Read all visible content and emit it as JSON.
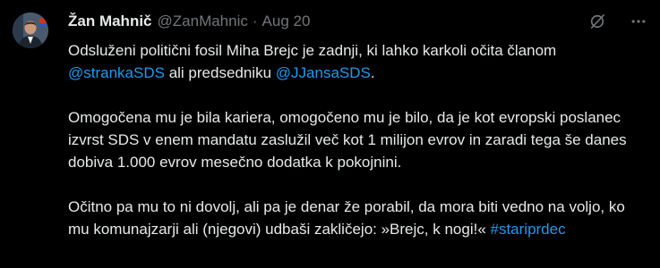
{
  "author": {
    "name": "Žan Mahnič",
    "handle": "@ZanMahnic",
    "separator": "·",
    "date": "Aug 20"
  },
  "icons": {
    "grok": "grok-icon",
    "more": "more-icon"
  },
  "colors": {
    "background": "#000000",
    "text": "#e7e9ea",
    "muted": "#71767b",
    "link": "#1d9bf0"
  },
  "tweet": {
    "p1": {
      "text1": "Odsluženi politični fosil Miha Brejc je zadnji, ki lahko karkoli očita članom ",
      "mention1": "@strankaSDS",
      "text2": " ali predsedniku  ",
      "mention2": "@JJansaSDS",
      "text3": "."
    },
    "p2": "Omogočena mu je bila kariera, omogočeno mu je bilo, da je kot evropski poslanec izvrst SDS v enem mandatu zaslužil več kot 1 milijon evrov in zaradi tega še danes dobiva 1.000 evrov mesečno dodatka k pokojnini.",
    "p3": {
      "text": "Očitno pa mu to ni dovolj, ali pa je denar že porabil, da mora biti vedno na voljo, ko mu komunajzarji ali (njegovi) udbaši zakličejo: »Brejc, k nogi!« ",
      "hashtag": "#stariprdec"
    }
  }
}
